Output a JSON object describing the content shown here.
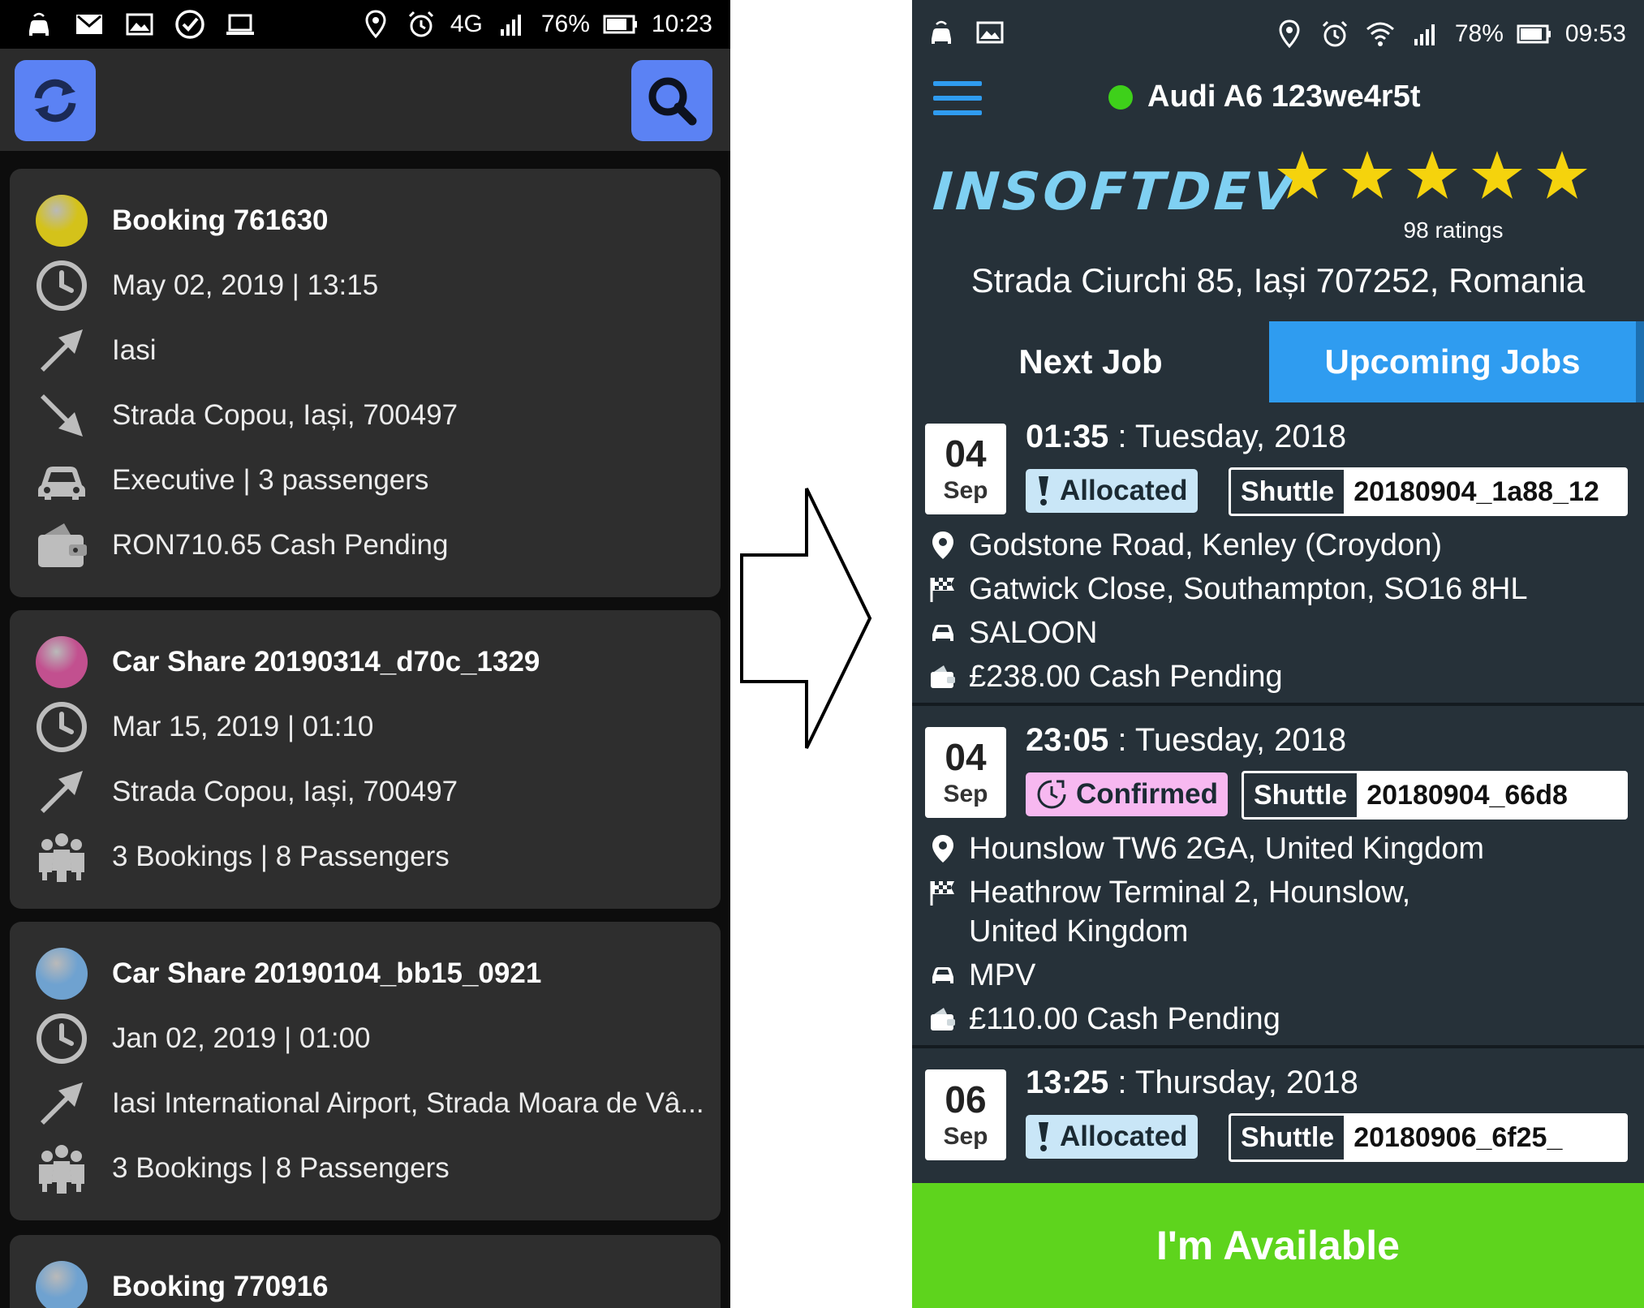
{
  "left": {
    "status": {
      "network": "4G",
      "battery": "76%",
      "time": "10:23"
    },
    "cards": [
      {
        "dot_color": "#d4c21a",
        "rows": [
          {
            "icon": "status-dot-icon",
            "text": "Booking 761630",
            "title": true
          },
          {
            "icon": "clock-icon",
            "text": "May 02, 2019 | 13:15"
          },
          {
            "icon": "pickup-arrow-icon",
            "text": "Iasi"
          },
          {
            "icon": "dropoff-arrow-icon",
            "text": "Strada Copou, Iași, 700497"
          },
          {
            "icon": "car-icon",
            "text": "Executive | 3 passengers"
          },
          {
            "icon": "wallet-icon",
            "text": "RON710.65  Cash  Pending"
          }
        ]
      },
      {
        "dot_color": "#c2508f",
        "rows": [
          {
            "icon": "status-dot-icon",
            "text": "Car Share 20190314_d70c_1329",
            "title": true
          },
          {
            "icon": "clock-icon",
            "text": "Mar 15, 2019 | 01:10"
          },
          {
            "icon": "pickup-arrow-icon",
            "text": "Strada Copou, Iași, 700497"
          },
          {
            "icon": "people-icon",
            "text": "3 Bookings | 8 Passengers"
          }
        ]
      },
      {
        "dot_color": "#6fa2d0",
        "rows": [
          {
            "icon": "status-dot-icon",
            "text": "Car Share 20190104_bb15_0921",
            "title": true
          },
          {
            "icon": "clock-icon",
            "text": "Jan 02, 2019 | 01:00"
          },
          {
            "icon": "pickup-arrow-icon",
            "text": "Iasi International Airport, Strada Moara de Vâ..."
          },
          {
            "icon": "people-icon",
            "text": "3 Bookings | 8 Passengers"
          }
        ]
      },
      {
        "dot_color": "#6fa2d0",
        "rows": [
          {
            "icon": "status-dot-icon",
            "text": "Booking 770916",
            "title": true
          }
        ]
      }
    ]
  },
  "right": {
    "status": {
      "battery": "78%",
      "time": "09:53"
    },
    "vehicle": {
      "name": "Audi A6 123we4r5t",
      "status_color": "#3ed01a"
    },
    "logo": "INSOFTDEV",
    "rating": {
      "stars": 5,
      "label": "98 ratings"
    },
    "address": "Strada Ciurchi 85, Iași 707252, Romania",
    "tabs": [
      {
        "label": "Next Job",
        "active": false
      },
      {
        "label": "Upcoming Jobs",
        "active": true
      }
    ],
    "jobs": [
      {
        "day": "04",
        "month": "Sep",
        "time": "01:35",
        "date_text": " : Tuesday, 2018",
        "status": "Allocated",
        "status_icon": "exclamation-icon",
        "status_color": "#c9e6f7",
        "shuttle_label": "Shuttle",
        "shuttle_id": "20180904_1a88_12",
        "pickup": "Godstone Road, Kenley (Croydon)",
        "dropoff": [
          "Gatwick Close, Southampton, SO16 8HL"
        ],
        "vehicle": "SALOON",
        "payment": "£238.00  Cash  Pending"
      },
      {
        "day": "04",
        "month": "Sep",
        "time": "23:05",
        "date_text": " : Tuesday, 2018",
        "status": "Confirmed",
        "status_icon": "clock-check-icon",
        "status_color": "#f7b8f0",
        "shuttle_label": "Shuttle",
        "shuttle_id": "20180904_66d8",
        "pickup": "Hounslow TW6 2GA, United Kingdom",
        "dropoff": [
          "Heathrow Terminal 2, Hounslow,",
          "United Kingdom"
        ],
        "vehicle": "MPV",
        "payment": "£110.00  Cash  Pending"
      },
      {
        "day": "06",
        "month": "Sep",
        "time": "13:25",
        "date_text": " : Thursday, 2018",
        "status": "Allocated",
        "status_icon": "exclamation-icon",
        "status_color": "#c9e6f7",
        "shuttle_label": "Shuttle",
        "shuttle_id": "20180906_6f25_"
      }
    ],
    "available_button": "I'm Available",
    "colors": {
      "accent": "#2f9cf0",
      "available": "#5ed41d",
      "bg": "#263139"
    }
  }
}
